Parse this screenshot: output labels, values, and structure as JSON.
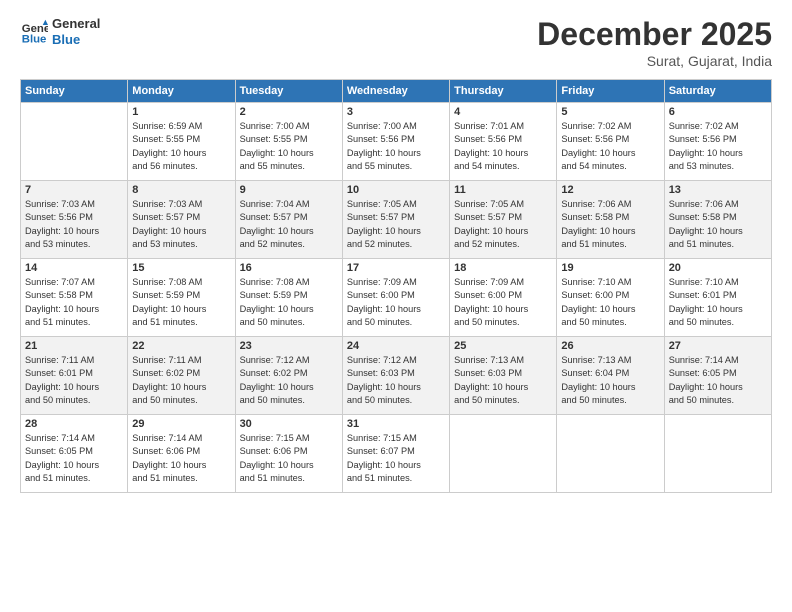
{
  "header": {
    "logo_line1": "General",
    "logo_line2": "Blue",
    "month": "December 2025",
    "location": "Surat, Gujarat, India"
  },
  "days_of_week": [
    "Sunday",
    "Monday",
    "Tuesday",
    "Wednesday",
    "Thursday",
    "Friday",
    "Saturday"
  ],
  "weeks": [
    [
      {
        "day": "",
        "info": ""
      },
      {
        "day": "1",
        "info": "Sunrise: 6:59 AM\nSunset: 5:55 PM\nDaylight: 10 hours\nand 56 minutes."
      },
      {
        "day": "2",
        "info": "Sunrise: 7:00 AM\nSunset: 5:55 PM\nDaylight: 10 hours\nand 55 minutes."
      },
      {
        "day": "3",
        "info": "Sunrise: 7:00 AM\nSunset: 5:56 PM\nDaylight: 10 hours\nand 55 minutes."
      },
      {
        "day": "4",
        "info": "Sunrise: 7:01 AM\nSunset: 5:56 PM\nDaylight: 10 hours\nand 54 minutes."
      },
      {
        "day": "5",
        "info": "Sunrise: 7:02 AM\nSunset: 5:56 PM\nDaylight: 10 hours\nand 54 minutes."
      },
      {
        "day": "6",
        "info": "Sunrise: 7:02 AM\nSunset: 5:56 PM\nDaylight: 10 hours\nand 53 minutes."
      }
    ],
    [
      {
        "day": "7",
        "info": "Sunrise: 7:03 AM\nSunset: 5:56 PM\nDaylight: 10 hours\nand 53 minutes."
      },
      {
        "day": "8",
        "info": "Sunrise: 7:03 AM\nSunset: 5:57 PM\nDaylight: 10 hours\nand 53 minutes."
      },
      {
        "day": "9",
        "info": "Sunrise: 7:04 AM\nSunset: 5:57 PM\nDaylight: 10 hours\nand 52 minutes."
      },
      {
        "day": "10",
        "info": "Sunrise: 7:05 AM\nSunset: 5:57 PM\nDaylight: 10 hours\nand 52 minutes."
      },
      {
        "day": "11",
        "info": "Sunrise: 7:05 AM\nSunset: 5:57 PM\nDaylight: 10 hours\nand 52 minutes."
      },
      {
        "day": "12",
        "info": "Sunrise: 7:06 AM\nSunset: 5:58 PM\nDaylight: 10 hours\nand 51 minutes."
      },
      {
        "day": "13",
        "info": "Sunrise: 7:06 AM\nSunset: 5:58 PM\nDaylight: 10 hours\nand 51 minutes."
      }
    ],
    [
      {
        "day": "14",
        "info": "Sunrise: 7:07 AM\nSunset: 5:58 PM\nDaylight: 10 hours\nand 51 minutes."
      },
      {
        "day": "15",
        "info": "Sunrise: 7:08 AM\nSunset: 5:59 PM\nDaylight: 10 hours\nand 51 minutes."
      },
      {
        "day": "16",
        "info": "Sunrise: 7:08 AM\nSunset: 5:59 PM\nDaylight: 10 hours\nand 50 minutes."
      },
      {
        "day": "17",
        "info": "Sunrise: 7:09 AM\nSunset: 6:00 PM\nDaylight: 10 hours\nand 50 minutes."
      },
      {
        "day": "18",
        "info": "Sunrise: 7:09 AM\nSunset: 6:00 PM\nDaylight: 10 hours\nand 50 minutes."
      },
      {
        "day": "19",
        "info": "Sunrise: 7:10 AM\nSunset: 6:00 PM\nDaylight: 10 hours\nand 50 minutes."
      },
      {
        "day": "20",
        "info": "Sunrise: 7:10 AM\nSunset: 6:01 PM\nDaylight: 10 hours\nand 50 minutes."
      }
    ],
    [
      {
        "day": "21",
        "info": "Sunrise: 7:11 AM\nSunset: 6:01 PM\nDaylight: 10 hours\nand 50 minutes."
      },
      {
        "day": "22",
        "info": "Sunrise: 7:11 AM\nSunset: 6:02 PM\nDaylight: 10 hours\nand 50 minutes."
      },
      {
        "day": "23",
        "info": "Sunrise: 7:12 AM\nSunset: 6:02 PM\nDaylight: 10 hours\nand 50 minutes."
      },
      {
        "day": "24",
        "info": "Sunrise: 7:12 AM\nSunset: 6:03 PM\nDaylight: 10 hours\nand 50 minutes."
      },
      {
        "day": "25",
        "info": "Sunrise: 7:13 AM\nSunset: 6:03 PM\nDaylight: 10 hours\nand 50 minutes."
      },
      {
        "day": "26",
        "info": "Sunrise: 7:13 AM\nSunset: 6:04 PM\nDaylight: 10 hours\nand 50 minutes."
      },
      {
        "day": "27",
        "info": "Sunrise: 7:14 AM\nSunset: 6:05 PM\nDaylight: 10 hours\nand 50 minutes."
      }
    ],
    [
      {
        "day": "28",
        "info": "Sunrise: 7:14 AM\nSunset: 6:05 PM\nDaylight: 10 hours\nand 51 minutes."
      },
      {
        "day": "29",
        "info": "Sunrise: 7:14 AM\nSunset: 6:06 PM\nDaylight: 10 hours\nand 51 minutes."
      },
      {
        "day": "30",
        "info": "Sunrise: 7:15 AM\nSunset: 6:06 PM\nDaylight: 10 hours\nand 51 minutes."
      },
      {
        "day": "31",
        "info": "Sunrise: 7:15 AM\nSunset: 6:07 PM\nDaylight: 10 hours\nand 51 minutes."
      },
      {
        "day": "",
        "info": ""
      },
      {
        "day": "",
        "info": ""
      },
      {
        "day": "",
        "info": ""
      }
    ]
  ]
}
